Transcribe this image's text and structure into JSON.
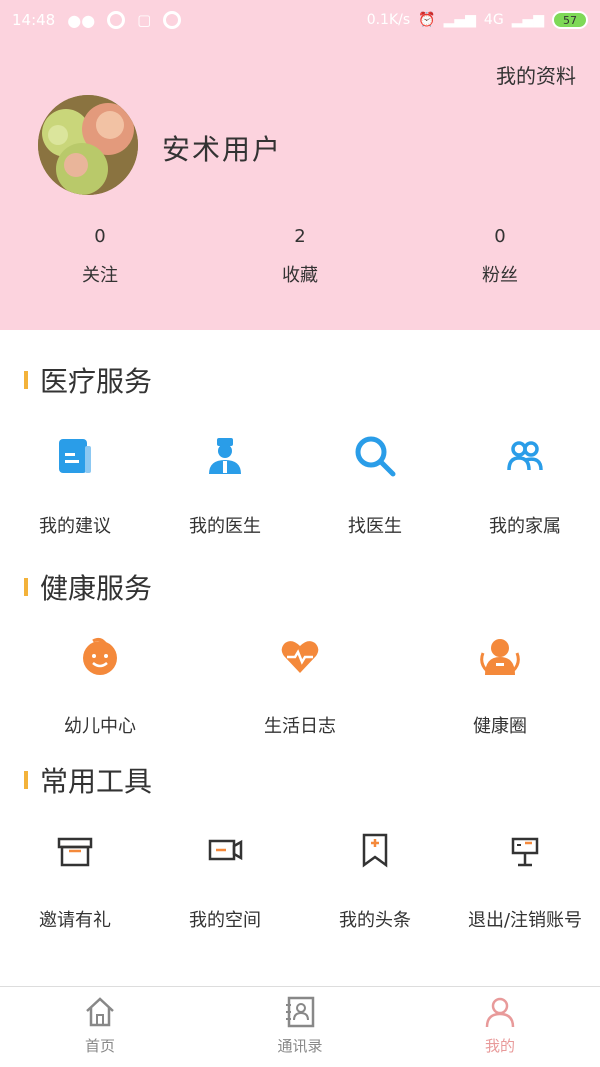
{
  "status_bar": {
    "time": "14:48",
    "speed": "0.1K/s",
    "network": "4G",
    "battery": "57"
  },
  "header": {
    "profile_link": "我的资料",
    "username": "安术用户",
    "stats": [
      {
        "value": "0",
        "label": "关注"
      },
      {
        "value": "2",
        "label": "收藏"
      },
      {
        "value": "0",
        "label": "粉丝"
      }
    ]
  },
  "sections": {
    "medical": {
      "title": "医疗服务",
      "items": [
        {
          "label": "我的建议",
          "icon": "document-icon"
        },
        {
          "label": "我的医生",
          "icon": "doctor-icon"
        },
        {
          "label": "找医生",
          "icon": "search-icon"
        },
        {
          "label": "我的家属",
          "icon": "family-icon"
        }
      ]
    },
    "health": {
      "title": "健康服务",
      "items": [
        {
          "label": "幼儿中心",
          "icon": "child-icon"
        },
        {
          "label": "生活日志",
          "icon": "heart-pulse-icon"
        },
        {
          "label": "健康圈",
          "icon": "user-circle-icon"
        }
      ]
    },
    "tools": {
      "title": "常用工具",
      "items": [
        {
          "label": "邀请有礼",
          "icon": "gift-icon"
        },
        {
          "label": "我的空间",
          "icon": "video-icon"
        },
        {
          "label": "我的头条",
          "icon": "bookmark-icon"
        },
        {
          "label": "退出/注销账号",
          "icon": "mailbox-icon"
        }
      ]
    }
  },
  "bottom_nav": {
    "items": [
      {
        "label": "首页",
        "icon": "home-icon"
      },
      {
        "label": "通讯录",
        "icon": "contacts-icon"
      },
      {
        "label": "我的",
        "icon": "person-icon"
      }
    ],
    "active_index": 2
  },
  "colors": {
    "header_bg": "#fcd3de",
    "accent_bar": "#f3b23a",
    "blue_icon": "#2a9de8",
    "orange_icon": "#f4893b",
    "nav_active": "#e89a9a"
  }
}
